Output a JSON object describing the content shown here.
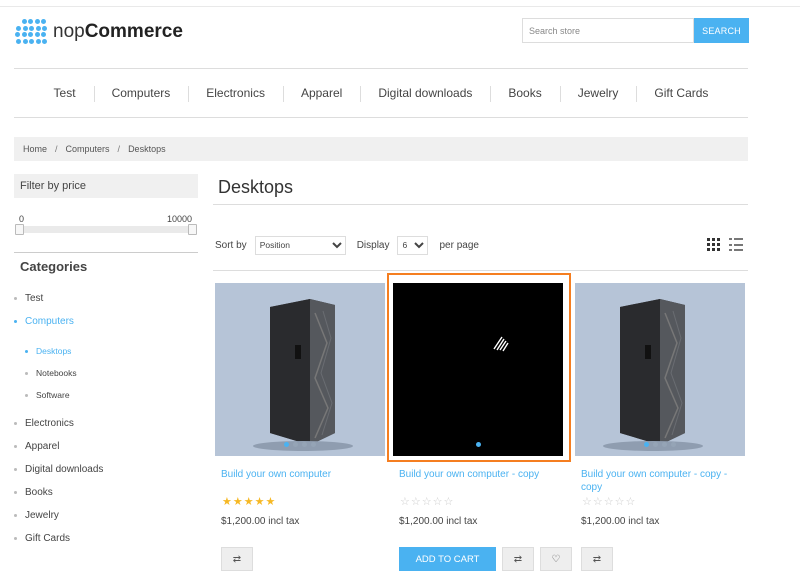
{
  "header": {
    "logo_prefix": "nop",
    "logo_bold": "Commerce",
    "search_placeholder": "Search store",
    "search_button": "SEARCH"
  },
  "menu": [
    "Test",
    "Computers",
    "Electronics",
    "Apparel",
    "Digital downloads",
    "Books",
    "Jewelry",
    "Gift Cards"
  ],
  "breadcrumb": {
    "home": "Home",
    "sep": "/",
    "category": "Computers",
    "current": "Desktops"
  },
  "filter": {
    "title": "Filter by price",
    "min": "0",
    "max": "10000"
  },
  "categories": {
    "title": "Categories",
    "items": [
      {
        "label": "Test"
      },
      {
        "label": "Computers"
      },
      {
        "label": "Desktops"
      },
      {
        "label": "Notebooks"
      },
      {
        "label": "Software"
      },
      {
        "label": "Electronics"
      },
      {
        "label": "Apparel"
      },
      {
        "label": "Digital downloads"
      },
      {
        "label": "Books"
      },
      {
        "label": "Jewelry"
      },
      {
        "label": "Gift Cards"
      }
    ]
  },
  "main": {
    "title": "Desktops",
    "sort_label": "Sort by",
    "sort_value": "Position",
    "display_label": "Display",
    "display_value": "6",
    "per_page": "per page"
  },
  "products": [
    {
      "name": "Build your own computer",
      "price": "$1,200.00 incl tax",
      "rating": 5,
      "add_to_cart": ""
    },
    {
      "name": "Build your own computer - copy",
      "price": "$1,200.00 incl tax",
      "rating": 0,
      "add_to_cart": "ADD TO CART"
    },
    {
      "name": "Build your own computer - copy - copy",
      "price": "$1,200.00 incl tax",
      "rating": 0,
      "add_to_cart": ""
    }
  ],
  "colors": {
    "accent": "#4ab2f1",
    "highlight": "#f57e20"
  }
}
